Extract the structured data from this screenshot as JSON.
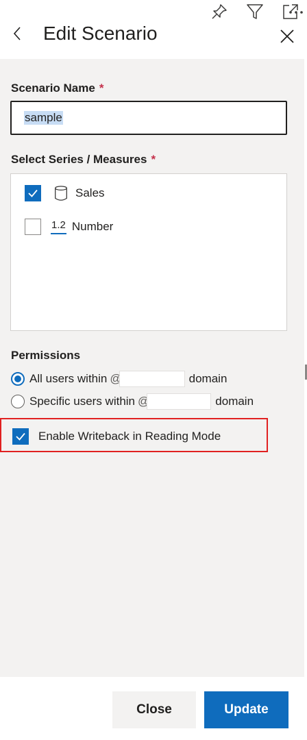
{
  "header": {
    "title": "Edit Scenario"
  },
  "toolbar_icons": [
    "pin-icon",
    "filter-icon",
    "expand-icon",
    "more-icon"
  ],
  "scenario_name": {
    "label": "Scenario Name",
    "required_mark": "*",
    "value": "sample"
  },
  "series": {
    "label": "Select Series / Measures",
    "required_mark": "*",
    "items": [
      {
        "label": "Sales",
        "checked": true,
        "icon": "database-icon"
      },
      {
        "label": "Number",
        "checked": false,
        "icon_text": "1.2"
      }
    ]
  },
  "permissions": {
    "label": "Permissions",
    "options": [
      {
        "text": "All users within",
        "at": "@",
        "suffix": "domain",
        "selected": true
      },
      {
        "text": "Specific users within",
        "at": "@",
        "suffix": "domain",
        "selected": false
      }
    ]
  },
  "writeback": {
    "label": "Enable Writeback in Reading Mode",
    "checked": true
  },
  "footer": {
    "close_label": "Close",
    "update_label": "Update"
  },
  "colors": {
    "accent": "#0f6cbd",
    "highlight_border": "#e02020",
    "required": "#c4314b",
    "panel_bg": "#f3f2f1"
  }
}
